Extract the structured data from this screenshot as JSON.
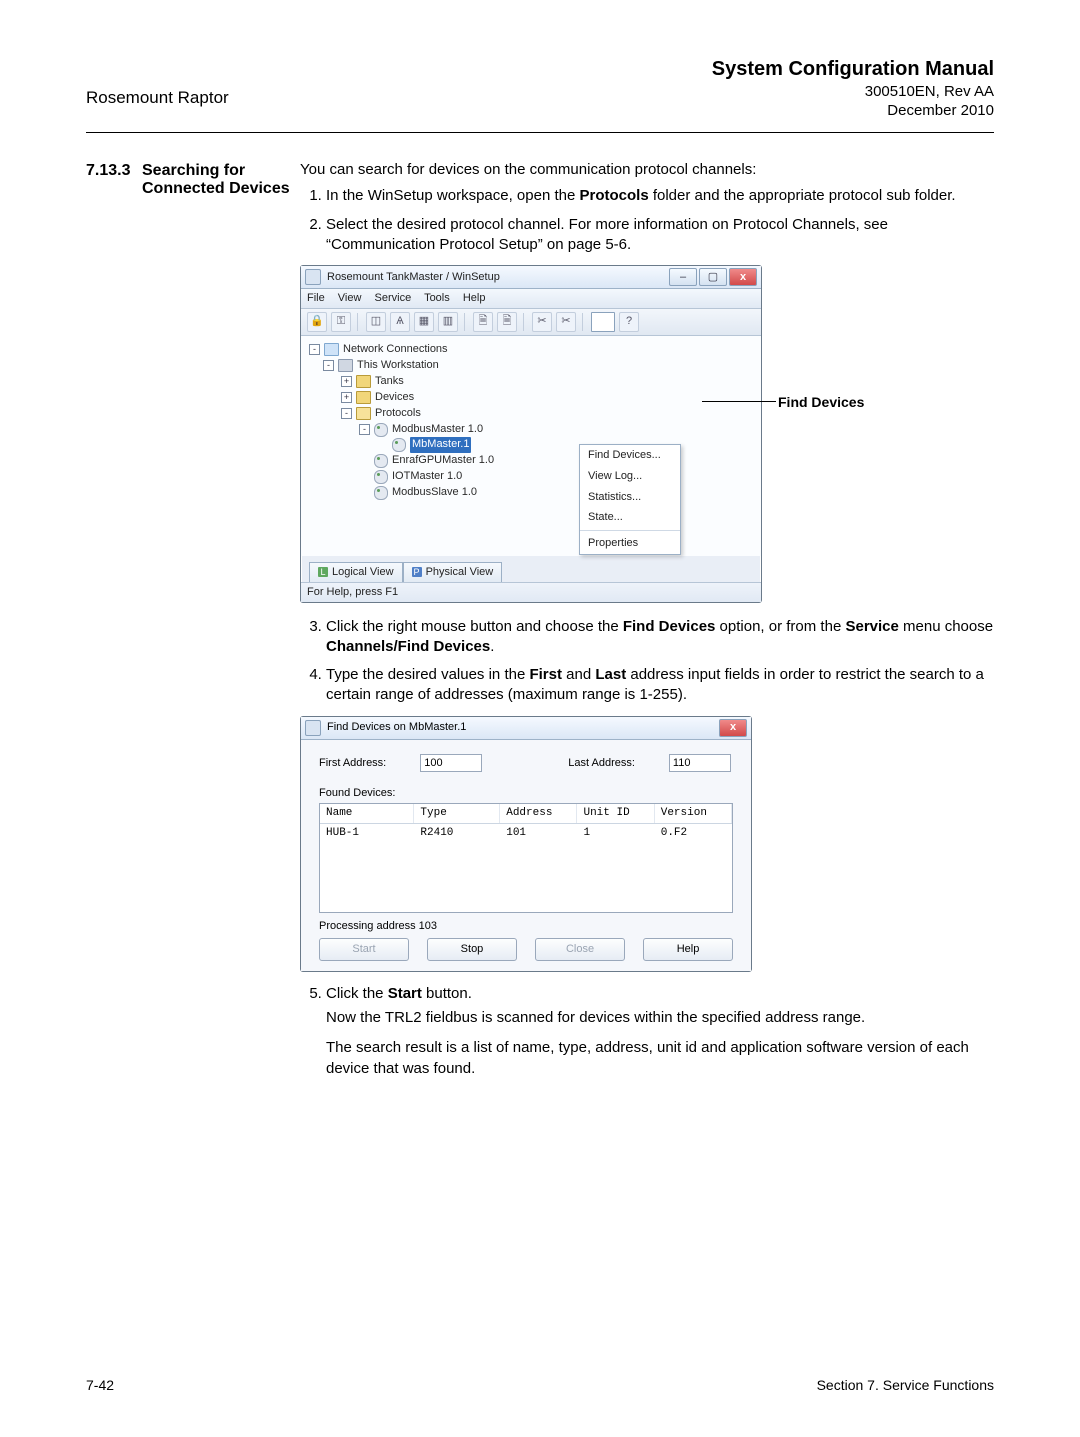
{
  "header": {
    "left": "Rosemount Raptor",
    "title": "System Configuration Manual",
    "docnum": "300510EN, Rev AA",
    "date": "December 2010"
  },
  "section": {
    "num": "7.13.3",
    "title": "Searching for Connected Devices"
  },
  "intro": "You can search for devices on the communication protocol channels:",
  "steps": {
    "s1a": "In the WinSetup workspace, open the ",
    "s1b": "Protocols",
    "s1c": " folder and the appropriate protocol sub folder.",
    "s2": "Select the desired protocol channel. For more information on Protocol Channels, see “Communication Protocol Setup” on page 5-6.",
    "s3a": "Click the right mouse button and choose the ",
    "s3b": "Find Devices",
    "s3c": " option, or from the ",
    "s3d": "Service",
    "s3e": " menu choose ",
    "s3f": "Channels/Find Devices",
    "s3g": ".",
    "s4a": "Type the desired values in the ",
    "s4b": "First",
    "s4c": " and ",
    "s4d": "Last",
    "s4e": " address input fields in order to restrict the search to a certain range of addresses (maximum range is 1-255).",
    "s5a": "Click the ",
    "s5b": "Start",
    "s5c": " button.",
    "s5d": "Now the TRL2 fieldbus is scanned for devices within the specified address range.",
    "s5e": "The search result is a list of name, type, address, unit id and application software version of each device that was found."
  },
  "winsetup": {
    "title": "Rosemount TankMaster / WinSetup",
    "menu": [
      "File",
      "View",
      "Service",
      "Tools",
      "Help"
    ],
    "tree": {
      "root": "Network Connections",
      "ws": "This Workstation",
      "tanks": "Tanks",
      "devices": "Devices",
      "protocols": "Protocols",
      "modbusMaster": "ModbusMaster 1.0",
      "selected": "MbMaster.1",
      "enraf": "EnrafGPUMaster 1.0",
      "iot": "IOTMaster 1.0",
      "slave": "ModbusSlave 1.0"
    },
    "context": [
      "Find Devices...",
      "View Log...",
      "Statistics...",
      "State...",
      "Properties"
    ],
    "tabs": {
      "logical": "Logical View",
      "physical": "Physical View"
    },
    "status": "For Help, press F1",
    "callout": "Find Devices"
  },
  "find_dlg": {
    "title": "Find Devices on MbMaster.1",
    "first_lbl": "First Address:",
    "first_val": "100",
    "last_lbl": "Last Address:",
    "last_val": "110",
    "found_lbl": "Found Devices:",
    "cols": [
      "Name",
      "Type",
      "Address",
      "Unit ID",
      "Version"
    ],
    "row": [
      "HUB-1",
      "R2410",
      "101",
      "1",
      "0.F2"
    ],
    "processing": "Processing address 103",
    "btns": {
      "start": "Start",
      "stop": "Stop",
      "close": "Close",
      "help": "Help"
    }
  },
  "footer": {
    "left": "7-42",
    "right": "Section 7. Service Functions"
  }
}
